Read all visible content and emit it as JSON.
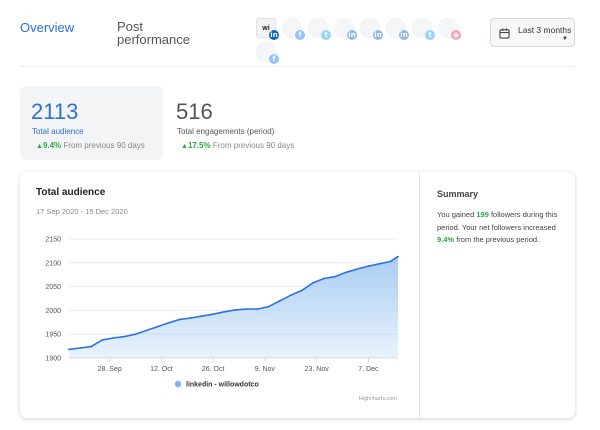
{
  "tabs": {
    "overview": "Overview",
    "post_performance": "Post performance"
  },
  "accounts": [
    {
      "type": "brand-logo",
      "text": "wi",
      "network": "linkedin",
      "selected": true
    },
    {
      "type": "avatar",
      "network": "facebook",
      "selected": false
    },
    {
      "type": "avatar",
      "network": "twitter",
      "selected": false
    },
    {
      "type": "avatar",
      "network": "linkedin",
      "selected": false
    },
    {
      "type": "avatar",
      "network": "linkedin",
      "selected": false
    },
    {
      "type": "avatar",
      "network": "linkedin",
      "selected": false
    },
    {
      "type": "avatar",
      "network": "twitter",
      "selected": false
    },
    {
      "type": "avatar",
      "network": "instagram",
      "selected": false
    },
    {
      "type": "avatar",
      "network": "facebook",
      "selected": false
    }
  ],
  "date_range_button": {
    "label": "Last 3 months",
    "icon": "calendar-icon"
  },
  "kpis": [
    {
      "value": "2113",
      "label": "Total audience",
      "change": "9.4%",
      "from": "From previous 90 days",
      "selected": true
    },
    {
      "value": "516",
      "label": "Total engagements (period)",
      "change": "17.5%",
      "from": "From previous 90 days",
      "selected": false
    }
  ],
  "card": {
    "title": "Total audience",
    "date_range": "17 Sep 2020 - 15 Dec 2020",
    "credit": "Highcharts.com"
  },
  "summary": {
    "title": "Summary",
    "p1": "You gained ",
    "gained": "199",
    "p2": " followers during this period. Your net followers increased ",
    "increase": "9.4%",
    "p3": " from the previous period."
  },
  "colors": {
    "accent": "#2f6fd6",
    "positive": "#29a845",
    "series": "#2a73e0",
    "area": "#a9cdf3"
  },
  "chart_data": {
    "type": "area",
    "title": "Total audience",
    "x_start": "2020-09-17",
    "x_end": "2020-12-15",
    "x_tick_labels": [
      "28. Sep",
      "12. Oct",
      "26. Oct",
      "9. Nov",
      "23. Nov",
      "7. Dec"
    ],
    "x_tick_dates": [
      "2020-09-28",
      "2020-10-12",
      "2020-10-26",
      "2020-11-09",
      "2020-11-23",
      "2020-12-07"
    ],
    "ylim": [
      1900,
      2150
    ],
    "y_ticks": [
      1900,
      1950,
      2000,
      2050,
      2100,
      2150
    ],
    "grid": true,
    "legend_position": "bottom-center",
    "series": [
      {
        "name": "linkedin - willowdotco",
        "x": [
          "2020-09-17",
          "2020-09-20",
          "2020-09-23",
          "2020-09-26",
          "2020-09-29",
          "2020-10-02",
          "2020-10-05",
          "2020-10-08",
          "2020-10-11",
          "2020-10-14",
          "2020-10-17",
          "2020-10-20",
          "2020-10-23",
          "2020-10-26",
          "2020-10-29",
          "2020-11-01",
          "2020-11-04",
          "2020-11-07",
          "2020-11-10",
          "2020-11-13",
          "2020-11-16",
          "2020-11-19",
          "2020-11-22",
          "2020-11-25",
          "2020-11-28",
          "2020-12-01",
          "2020-12-04",
          "2020-12-07",
          "2020-12-10",
          "2020-12-13",
          "2020-12-15"
        ],
        "y": [
          1918,
          1921,
          1924,
          1938,
          1942,
          1945,
          1950,
          1958,
          1966,
          1974,
          1981,
          1984,
          1988,
          1992,
          1997,
          2001,
          2003,
          2003,
          2008,
          2020,
          2032,
          2042,
          2058,
          2067,
          2071,
          2080,
          2087,
          2093,
          2098,
          2103,
          2113
        ]
      }
    ]
  }
}
